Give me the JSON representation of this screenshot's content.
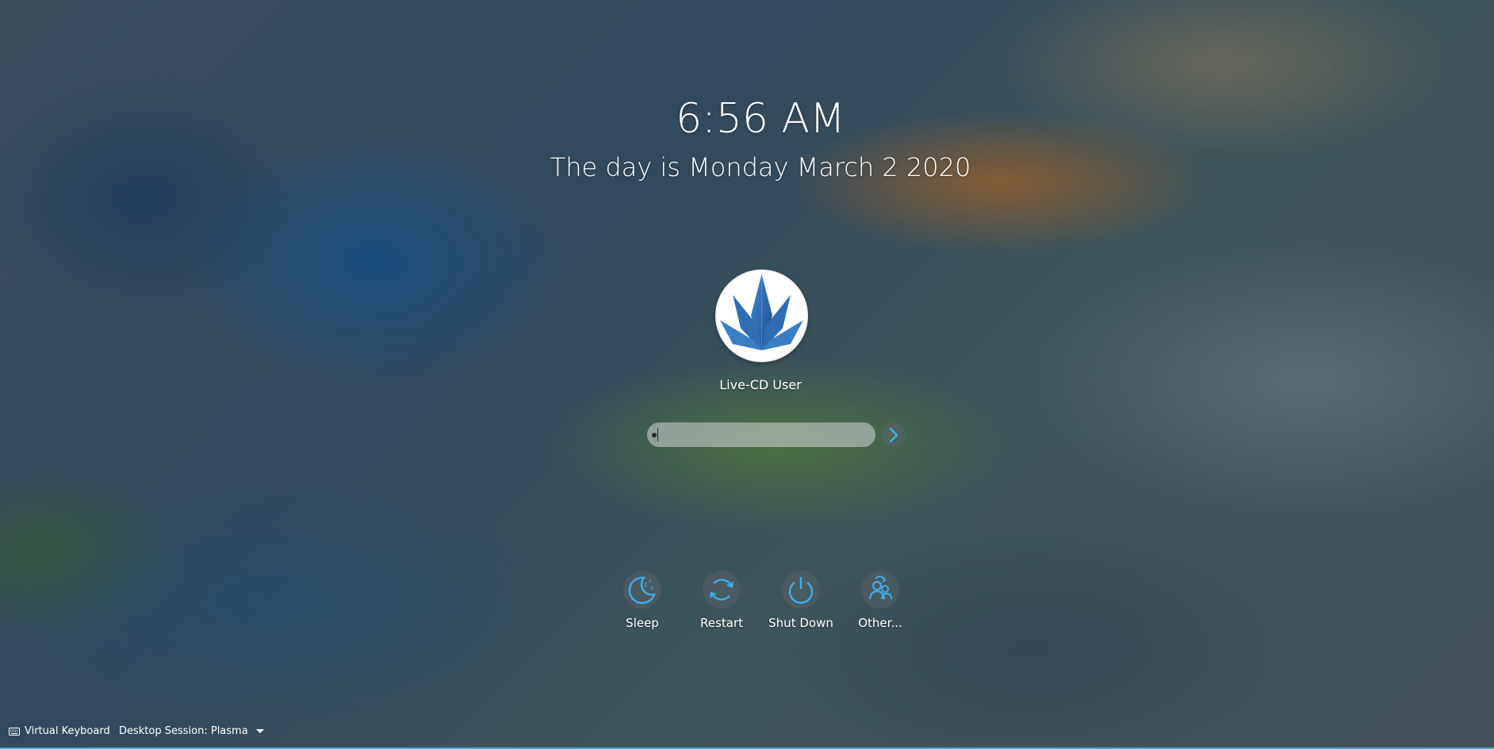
{
  "clock": {
    "time": "6:56 AM",
    "date": "The day is Monday March 2 2020"
  },
  "user": {
    "name": "Live-CD User",
    "avatar_icon": "leaf-logo-icon"
  },
  "password_field": {
    "value": "",
    "placeholder": ""
  },
  "login_button": {
    "icon": "chevron-right-icon"
  },
  "actions": [
    {
      "label": "Sleep",
      "icon": "sleep-icon"
    },
    {
      "label": "Restart",
      "icon": "restart-icon"
    },
    {
      "label": "Shut Down",
      "icon": "shutdown-icon"
    },
    {
      "label": "Other...",
      "icon": "switch-user-icon"
    }
  ],
  "bottom_bar": {
    "virtual_keyboard_label": "Virtual Keyboard",
    "session_label": "Desktop Session: Plasma"
  },
  "colors": {
    "accent": "#3daee9",
    "logo_blue": "#2a6bb0"
  }
}
